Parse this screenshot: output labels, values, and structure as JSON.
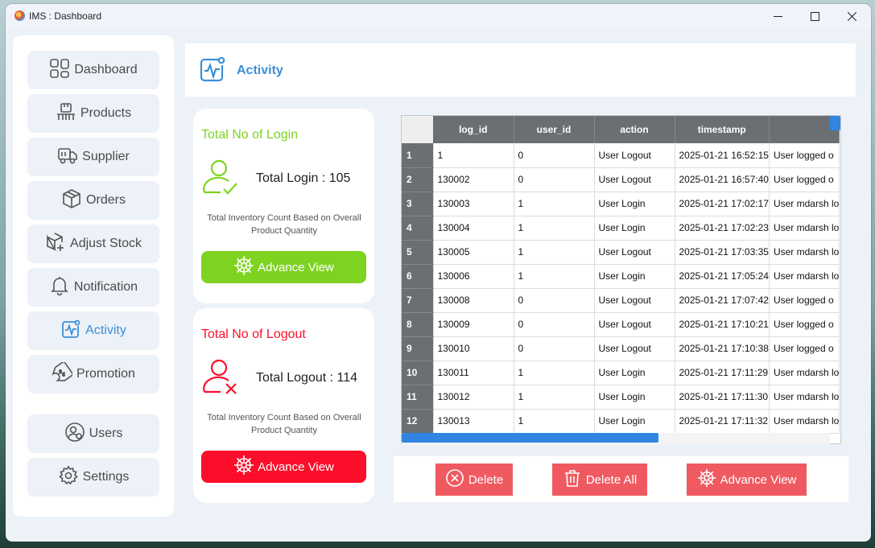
{
  "window": {
    "title": "IMS : Dashboard"
  },
  "sidebar": {
    "items": [
      {
        "label": "Dashboard",
        "icon": "dashboard-grid-icon",
        "active": false
      },
      {
        "label": "Products",
        "icon": "products-icon",
        "active": false
      },
      {
        "label": "Supplier",
        "icon": "truck-icon",
        "active": false
      },
      {
        "label": "Orders",
        "icon": "box-icon",
        "active": false
      },
      {
        "label": "Adjust Stock",
        "icon": "box-plus-icon",
        "active": false
      },
      {
        "label": "Notification",
        "icon": "bell-icon",
        "active": false
      },
      {
        "label": "Activity",
        "icon": "activity-icon",
        "active": true
      },
      {
        "label": "Promotion",
        "icon": "ticket-icon",
        "active": false
      },
      {
        "label": "Users",
        "icon": "users-icon",
        "active": false
      },
      {
        "label": "Settings",
        "icon": "gear-icon",
        "active": false
      }
    ]
  },
  "header": {
    "title": "Activity",
    "icon": "activity-icon"
  },
  "login_card": {
    "title": "Total No of Login",
    "total": "Total Login : 105",
    "description": "Total Inventory Count Based on Overall Product Quantity",
    "button": "Advance View",
    "color": "#7ed321"
  },
  "logout_card": {
    "title": "Total No of Logout",
    "total": "Total Logout : 114",
    "description": "Total Inventory Count Based on Overall Product Quantity",
    "button": "Advance View",
    "color": "#fb0e2a"
  },
  "table": {
    "columns": [
      "log_id",
      "user_id",
      "action",
      "timestamp",
      ""
    ],
    "rows": [
      {
        "n": "1",
        "cells": [
          "1",
          "0",
          "User Logout",
          "2025-01-21 16:52:15",
          "User  logged o"
        ]
      },
      {
        "n": "2",
        "cells": [
          "130002",
          "0",
          "User Logout",
          "2025-01-21 16:57:40",
          "User  logged o"
        ]
      },
      {
        "n": "3",
        "cells": [
          "130003",
          "1",
          "User Login",
          "2025-01-21 17:02:17",
          "User mdarsh lo"
        ]
      },
      {
        "n": "4",
        "cells": [
          "130004",
          "1",
          "User Login",
          "2025-01-21 17:02:23",
          "User mdarsh lo"
        ]
      },
      {
        "n": "5",
        "cells": [
          "130005",
          "1",
          "User Logout",
          "2025-01-21 17:03:35",
          "User mdarsh lo"
        ]
      },
      {
        "n": "6",
        "cells": [
          "130006",
          "1",
          "User Login",
          "2025-01-21 17:05:24",
          "User mdarsh lo"
        ]
      },
      {
        "n": "7",
        "cells": [
          "130008",
          "0",
          "User Logout",
          "2025-01-21 17:07:42",
          "User  logged o"
        ]
      },
      {
        "n": "8",
        "cells": [
          "130009",
          "0",
          "User Logout",
          "2025-01-21 17:10:21",
          "User  logged o"
        ]
      },
      {
        "n": "9",
        "cells": [
          "130010",
          "0",
          "User Logout",
          "2025-01-21 17:10:38",
          "User  logged o"
        ]
      },
      {
        "n": "10",
        "cells": [
          "130011",
          "1",
          "User Login",
          "2025-01-21 17:11:29",
          "User mdarsh lo"
        ]
      },
      {
        "n": "11",
        "cells": [
          "130012",
          "1",
          "User Login",
          "2025-01-21 17:11:30",
          "User mdarsh lo"
        ]
      },
      {
        "n": "12",
        "cells": [
          "130013",
          "1",
          "User Login",
          "2025-01-21 17:11:32",
          "User mdarsh lo"
        ]
      }
    ]
  },
  "actions": {
    "delete": "Delete",
    "delete_all": "Delete All",
    "advance_view": "Advance View"
  }
}
